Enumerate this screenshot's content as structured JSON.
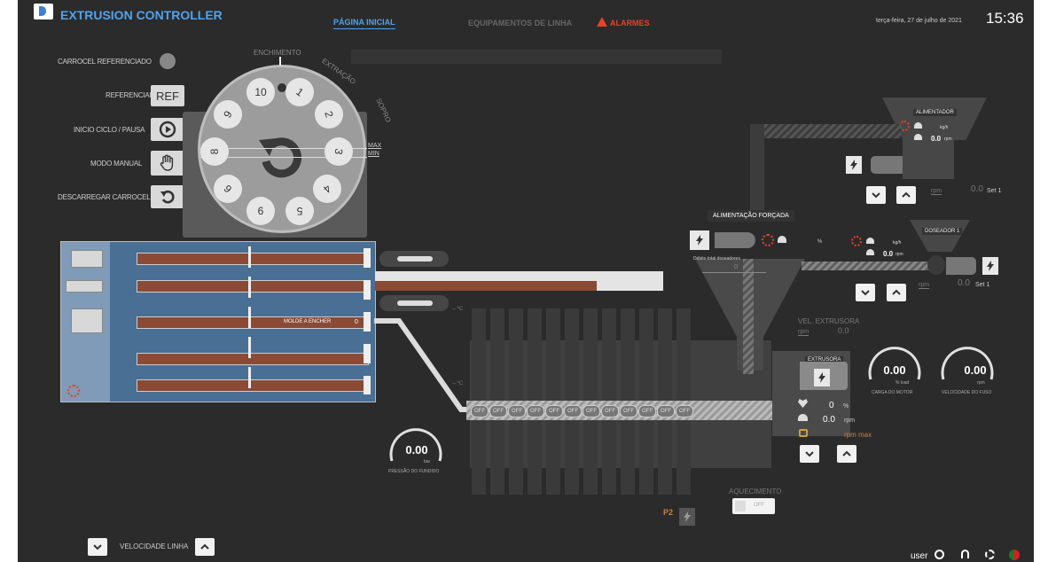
{
  "header": {
    "title": "EXTRUSION CONTROLLER",
    "nav": [
      "PÁGINA INICIAL",
      "EQUIPAMENTOS DE LINHA",
      "ALARMES"
    ],
    "date": "terça-feira, 27 de julho de 2021",
    "time": "15:36"
  },
  "left_panel": {
    "carrocel_ref": "CARROCEL REFERENCIADO",
    "referenciar": "REFERENCIAR",
    "ref_btn": "REF",
    "inicio": "INICIO CICLO / PAUSA",
    "modo_manual": "MODO MANUAL",
    "descarregar": "DESCARREGAR CARROCEL"
  },
  "carousel": {
    "enchimento": "ENCHIMENTO",
    "extracao": "EXTRAÇÃO",
    "sopro": "SOPRO",
    "max": "MAX",
    "min": "MIN",
    "slots": [
      "10",
      "1",
      "2",
      "3",
      "4",
      "5",
      "6",
      "7",
      "8",
      "9"
    ]
  },
  "molds": {
    "moulder_label": "MOLDE A ENCHER",
    "moulder_value": "0"
  },
  "alimentador": {
    "title": "ALIMENTADOR",
    "kgh_unit": "kg/h",
    "rpm_value": "0.0",
    "rpm_unit": "rpm",
    "set_rpm_label": "rpm",
    "set_value": "0.0",
    "set_label": "Set 1"
  },
  "alimentacao": {
    "title": "ALIMENTAÇÃO FORÇADA",
    "percent": "%",
    "debito": "Débito total doseadores",
    "debito_value": "0"
  },
  "doseador": {
    "title": "DOSEADOR 1",
    "kgh_unit": "kg/h",
    "rpm_value": "0.0",
    "rpm_unit": "rpm",
    "set_rpm_label": "rpm",
    "set_value": "0.0",
    "set_label": "Set 1"
  },
  "extrusora": {
    "vel_label": "VEL. EXTRUSORA",
    "vel_unit": "rpm",
    "vel_value": "0.0",
    "title": "EXTRUSORA",
    "pct_value": "0",
    "pct_unit": "%",
    "rpm_value": "0.0",
    "rpm_unit": "rpm",
    "rpm_max": "rpm max"
  },
  "gauges": {
    "carga_value": "0.00",
    "carga_unit": "% load",
    "carga_label": "CARGA DO MOTOR",
    "vel_value": "0.00",
    "vel_unit": "rpm",
    "vel_label": "VELOCIDADE DO FUSO",
    "pressao_value": "0.00",
    "pressao_unit": "bar",
    "pressao_label": "PRESSÃO DO FUNDIDO"
  },
  "heaters": {
    "temp_top": "-- ºC",
    "temp_mid": "-- ºC",
    "off_labels": [
      "OFF",
      "OFF",
      "OFF",
      "OFF",
      "OFF",
      "OFF",
      "OFF",
      "OFF",
      "OFF",
      "OFF",
      "OFF",
      "OFF"
    ],
    "p2": "P2"
  },
  "aquecimento": {
    "label": "AQUECIMENTO",
    "toggle": "OFF"
  },
  "footer": {
    "velocidade": "VELOCIDADE LINHA",
    "user": "user"
  },
  "colors": {
    "accent_blue": "#5aaaf0",
    "alarm_red": "#e8402a",
    "mold_brown": "#8a4a35",
    "mold_panel": "#4a6f95"
  }
}
